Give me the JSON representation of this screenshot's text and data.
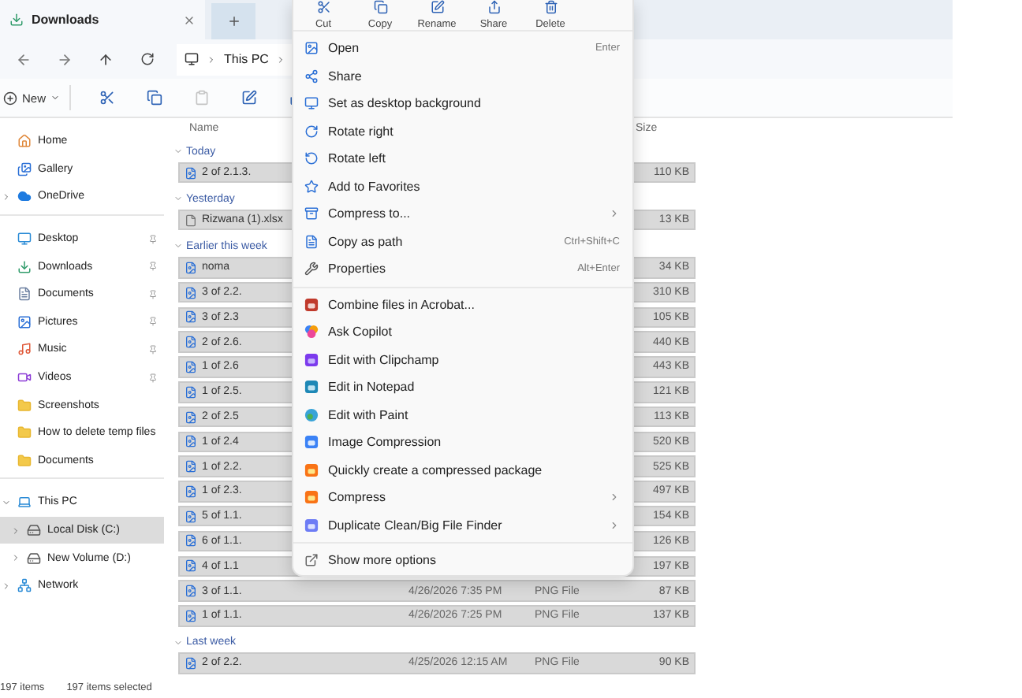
{
  "tabs": [
    {
      "label": "Downloads",
      "selected": true
    }
  ],
  "address": {
    "crumbs": [
      "This PC"
    ]
  },
  "toolbar": {
    "new_label": "New"
  },
  "sidebar": {
    "sections": [
      [
        {
          "label": "Home",
          "selected": false
        },
        {
          "label": "Gallery",
          "selected": false
        },
        {
          "label": "OneDrive",
          "selected": false,
          "expanded": false
        }
      ],
      [
        {
          "label": "Desktop",
          "selected": false,
          "pinned": true
        },
        {
          "label": "Downloads",
          "selected": false,
          "pinned": true
        },
        {
          "label": "Documents",
          "selected": false,
          "pinned": true
        },
        {
          "label": "Pictures",
          "selected": false,
          "pinned": true
        },
        {
          "label": "Music",
          "selected": false,
          "pinned": true
        },
        {
          "label": "Videos",
          "selected": false,
          "pinned": true
        },
        {
          "label": "Screenshots",
          "selected": false,
          "pinned": false
        },
        {
          "label": "How to delete temp files",
          "selected": false,
          "pinned": false
        },
        {
          "label": "Documents",
          "selected": false,
          "pinned": false
        }
      ],
      [
        {
          "label": "This PC",
          "selected": false,
          "expanded": true,
          "children": [
            {
              "label": "Local Disk (C:)",
              "selected": true,
              "expanded": false
            },
            {
              "label": "New Volume (D:)",
              "selected": false,
              "expanded": false
            }
          ]
        },
        {
          "label": "Network",
          "selected": false,
          "expanded": false
        }
      ]
    ]
  },
  "file_list": {
    "columns": [
      "Name",
      "Size"
    ],
    "groups": [
      {
        "label": "Today",
        "rows": [
          {
            "name": "2 of 2.1.3.",
            "size": "110 KB",
            "kind": "image",
            "selected": true
          }
        ]
      },
      {
        "label": "Yesterday",
        "rows": [
          {
            "name": "Rizwana (1).xlsx",
            "size": "13 KB",
            "kind": "doc",
            "selected": true
          }
        ]
      },
      {
        "label": "Earlier this week",
        "rows": [
          {
            "name": "noma",
            "size": "34 KB",
            "kind": "image",
            "selected": true
          },
          {
            "name": "3 of 2.2.",
            "size": "310 KB",
            "kind": "image",
            "selected": true
          },
          {
            "name": "3 of 2.3",
            "size": "105 KB",
            "kind": "image",
            "selected": true
          },
          {
            "name": "2 of 2.6.",
            "size": "440 KB",
            "kind": "image",
            "selected": true
          },
          {
            "name": "1 of 2.6",
            "size": "443 KB",
            "kind": "image",
            "selected": true
          },
          {
            "name": "1 of 2.5.",
            "size": "121 KB",
            "kind": "image",
            "selected": true
          },
          {
            "name": "2 of 2.5",
            "size": "113 KB",
            "kind": "image",
            "selected": true
          },
          {
            "name": "1 of 2.4",
            "size": "520 KB",
            "kind": "image",
            "selected": true
          },
          {
            "name": "1 of 2.2.",
            "size": "525 KB",
            "kind": "image",
            "selected": true
          },
          {
            "name": "1 of 2.3.",
            "size": "497 KB",
            "kind": "image",
            "selected": true
          },
          {
            "name": "5 of 1.1.",
            "size": "154 KB",
            "kind": "image",
            "selected": true
          },
          {
            "name": "6 of 1.1.",
            "size": "126 KB",
            "kind": "image",
            "selected": true
          },
          {
            "name": "4 of 1.1",
            "size": "197 KB",
            "kind": "image",
            "selected": true
          },
          {
            "name": "3 of 1.1.",
            "date": "4/26/2026 7:35 PM",
            "type": "PNG File",
            "size": "87 KB",
            "kind": "image",
            "selected": true
          },
          {
            "name": "1 of 1.1.",
            "date": "4/26/2026 7:25 PM",
            "type": "PNG File",
            "size": "137 KB",
            "kind": "image",
            "selected": true
          }
        ]
      },
      {
        "label": "Last week",
        "rows": [
          {
            "name": "2 of 2.2.",
            "date": "4/25/2026 12:15 AM",
            "type": "PNG File",
            "size": "90 KB",
            "kind": "image",
            "selected": true
          }
        ]
      }
    ]
  },
  "context_menu": {
    "actions": [
      "Cut",
      "Copy",
      "Rename",
      "Share",
      "Delete"
    ],
    "sections": [
      [
        {
          "label": "Open",
          "shortcut": "Enter"
        },
        {
          "label": "Share"
        },
        {
          "label": "Set as desktop background"
        },
        {
          "label": "Rotate right"
        },
        {
          "label": "Rotate left"
        },
        {
          "label": "Add to Favorites"
        },
        {
          "label": "Compress to...",
          "submenu": true
        },
        {
          "label": "Copy as path",
          "shortcut": "Ctrl+Shift+C"
        },
        {
          "label": "Properties",
          "shortcut": "Alt+Enter"
        }
      ],
      [
        {
          "label": "Combine files in Acrobat..."
        },
        {
          "label": "Ask Copilot"
        },
        {
          "label": "Edit with Clipchamp"
        },
        {
          "label": "Edit in Notepad"
        },
        {
          "label": "Edit with Paint"
        },
        {
          "label": "Image Compression"
        },
        {
          "label": "Quickly create a compressed package"
        },
        {
          "label": "Compress",
          "submenu": true
        },
        {
          "label": "Duplicate Clean/Big File Finder",
          "submenu": true
        }
      ],
      [
        {
          "label": "Show more options"
        }
      ]
    ]
  },
  "status_bar": {
    "count": "197 items",
    "selection": "197 items selected"
  }
}
